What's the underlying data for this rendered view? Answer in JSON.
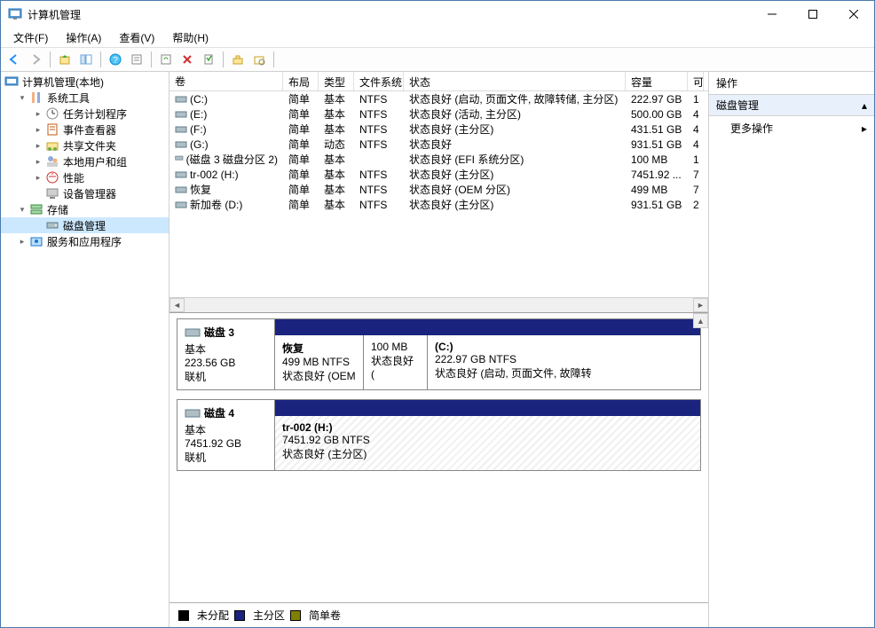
{
  "window": {
    "title": "计算机管理"
  },
  "menu": {
    "file": "文件(F)",
    "action": "操作(A)",
    "view": "查看(V)",
    "help": "帮助(H)"
  },
  "tree": {
    "root": "计算机管理(本地)",
    "systools": "系统工具",
    "scheduler": "任务计划程序",
    "eventviewer": "事件查看器",
    "shared": "共享文件夹",
    "users": "本地用户和组",
    "perf": "性能",
    "devmgr": "设备管理器",
    "storage": "存储",
    "diskmgmt": "磁盘管理",
    "services": "服务和应用程序"
  },
  "columns": {
    "volume": "卷",
    "layout": "布局",
    "type": "类型",
    "fs": "文件系统",
    "status": "状态",
    "capacity": "容量",
    "last": "可"
  },
  "volumes": [
    {
      "name": "(C:)",
      "layout": "简单",
      "type": "基本",
      "fs": "NTFS",
      "status": "状态良好 (启动, 页面文件, 故障转储, 主分区)",
      "cap": "222.97 GB",
      "x": "1"
    },
    {
      "name": "(E:)",
      "layout": "简单",
      "type": "基本",
      "fs": "NTFS",
      "status": "状态良好 (活动, 主分区)",
      "cap": "500.00 GB",
      "x": "4"
    },
    {
      "name": "(F:)",
      "layout": "简单",
      "type": "基本",
      "fs": "NTFS",
      "status": "状态良好 (主分区)",
      "cap": "431.51 GB",
      "x": "4"
    },
    {
      "name": "(G:)",
      "layout": "简单",
      "type": "动态",
      "fs": "NTFS",
      "status": "状态良好",
      "cap": "931.51 GB",
      "x": "4"
    },
    {
      "name": "(磁盘 3 磁盘分区 2)",
      "layout": "简单",
      "type": "基本",
      "fs": "",
      "status": "状态良好 (EFI 系统分区)",
      "cap": "100 MB",
      "x": "1"
    },
    {
      "name": "tr-002 (H:)",
      "layout": "简单",
      "type": "基本",
      "fs": "NTFS",
      "status": "状态良好 (主分区)",
      "cap": "7451.92 ...",
      "x": "7"
    },
    {
      "name": "恢复",
      "layout": "简单",
      "type": "基本",
      "fs": "NTFS",
      "status": "状态良好 (OEM 分区)",
      "cap": "499 MB",
      "x": "7"
    },
    {
      "name": "新加卷 (D:)",
      "layout": "简单",
      "type": "基本",
      "fs": "NTFS",
      "status": "状态良好 (主分区)",
      "cap": "931.51 GB",
      "x": "2"
    }
  ],
  "disks": {
    "d3": {
      "title": "磁盘 3",
      "type": "基本",
      "size": "223.56 GB",
      "status": "联机",
      "p1": {
        "name": "恢复",
        "line2": "499 MB NTFS",
        "line3": "状态良好 (OEM"
      },
      "p2": {
        "name": "",
        "line2": "100 MB",
        "line3": "状态良好 ("
      },
      "p3": {
        "name": "(C:)",
        "line2": "222.97 GB NTFS",
        "line3": "状态良好 (启动, 页面文件, 故障转"
      }
    },
    "d4": {
      "title": "磁盘 4",
      "type": "基本",
      "size": "7451.92 GB",
      "status": "联机",
      "p1": {
        "name": "tr-002  (H:)",
        "line2": "7451.92 GB NTFS",
        "line3": "状态良好 (主分区)"
      }
    }
  },
  "legend": {
    "unalloc": "未分配",
    "primary": "主分区",
    "simple": "简单卷"
  },
  "actions": {
    "header": "操作",
    "section": "磁盘管理",
    "more": "更多操作"
  }
}
